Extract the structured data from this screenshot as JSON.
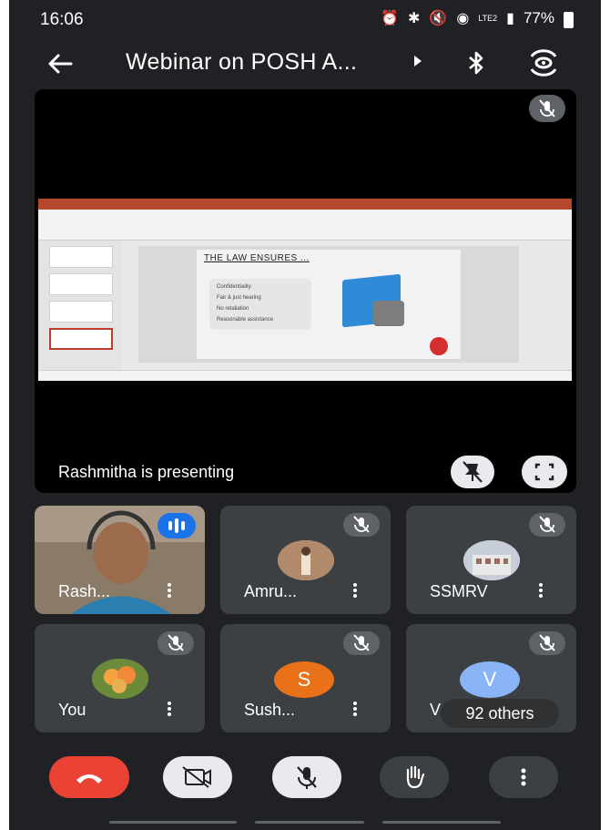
{
  "status_bar": {
    "time": "16:06",
    "battery": "77%",
    "network": "LTE2",
    "icons": [
      "alarm-icon",
      "bluetooth-icon",
      "mute-icon",
      "wifi-icon",
      "signal-icon",
      "battery-icon"
    ]
  },
  "app_bar": {
    "title": "Webinar on POSH A...",
    "back_icon": "arrow-left-icon",
    "bluetooth_icon": "bluetooth-icon",
    "switch_camera_icon": "switch-camera-icon"
  },
  "stage": {
    "presenting_label": "Rashmitha is presenting",
    "slide": {
      "heading": "THE LAW ENSURES ...",
      "bullets": [
        "Confidentiality",
        "Fair & just hearing",
        "No retaliation",
        "Reasonable assistance"
      ]
    }
  },
  "participants": [
    {
      "name": "Rash...",
      "speaking": true
    },
    {
      "name": "Amru...",
      "muted": true
    },
    {
      "name": "SSMRV",
      "muted": true
    },
    {
      "name": "You",
      "muted": true
    },
    {
      "name": "Sush...",
      "muted": true,
      "avatar_letter": "S"
    },
    {
      "name": "V",
      "muted": true,
      "avatar_letter": "V"
    }
  ],
  "others_label": "92 others",
  "controls": {
    "end_call": "end-call-icon",
    "camera": "camera-off-icon",
    "mic": "mic-off-icon",
    "raise_hand": "raise-hand-icon",
    "more": "more-vertical-icon"
  },
  "colors": {
    "background": "#202124",
    "tile": "#3c4043",
    "end_call": "#ea4335",
    "speaking": "#1a73e8",
    "avatar_s": "#e8711a",
    "avatar_v": "#8ab4f8"
  }
}
